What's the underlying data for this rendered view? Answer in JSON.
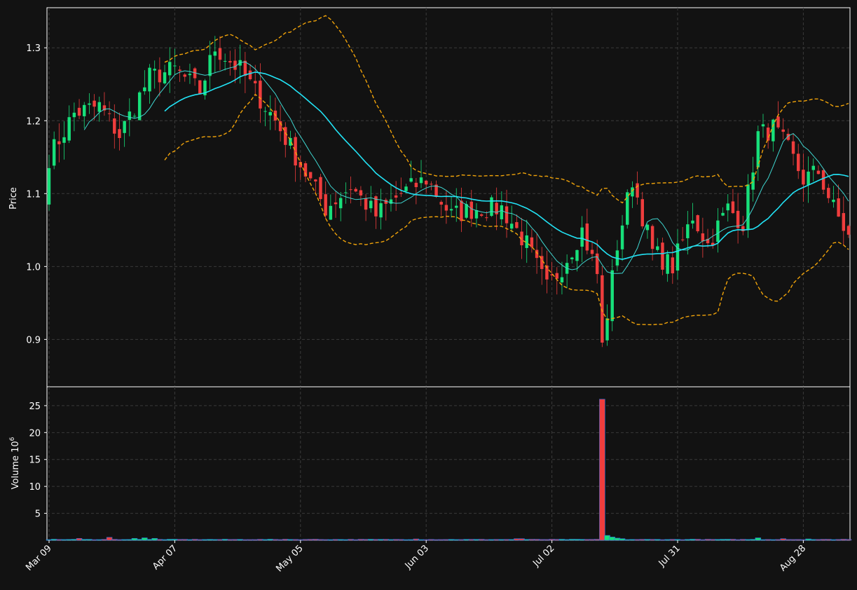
{
  "colors": {
    "background": "#121212",
    "up": "#17e07a",
    "down": "#ef3d3d",
    "ma_fast": "#3fd6d0",
    "ma_slow": "#22e3f5",
    "bollinger": "#f0a30a",
    "grid": "#3a3a3a",
    "frame": "#ffffff",
    "volume_edge": "#2f6fe0"
  },
  "chart_data": [
    {
      "type": "candlestick",
      "ylabel": "Price",
      "ylim": [
        0.835,
        1.355
      ],
      "yticks": [
        "0.9",
        "1.0",
        "1.1",
        "1.2",
        "1.3"
      ],
      "ytick_values": [
        0.9,
        1.0,
        1.1,
        1.2,
        1.3
      ],
      "grid": true,
      "n_bars": 160,
      "x_tick_labels": [
        "Mar 09",
        "Apr 07",
        "May 05",
        "Jun 03",
        "Jul 02",
        "Jul 31",
        "Aug 28"
      ],
      "x_tick_index": [
        0,
        25,
        50,
        75,
        100,
        125,
        150
      ],
      "anchors": [
        [
          0,
          1.15
        ],
        [
          5,
          1.21
        ],
        [
          10,
          1.22
        ],
        [
          14,
          1.18
        ],
        [
          20,
          1.26
        ],
        [
          25,
          1.27
        ],
        [
          30,
          1.24
        ],
        [
          33,
          1.3
        ],
        [
          38,
          1.27
        ],
        [
          45,
          1.2
        ],
        [
          50,
          1.14
        ],
        [
          55,
          1.08
        ],
        [
          60,
          1.11
        ],
        [
          65,
          1.07
        ],
        [
          70,
          1.1
        ],
        [
          75,
          1.12
        ],
        [
          80,
          1.07
        ],
        [
          85,
          1.08
        ],
        [
          90,
          1.08
        ],
        [
          95,
          1.03
        ],
        [
          99,
          0.97
        ],
        [
          102,
          1.0
        ],
        [
          106,
          1.05
        ],
        [
          109,
          0.99
        ],
        [
          110,
          0.89
        ],
        [
          113,
          1.03
        ],
        [
          116,
          1.12
        ],
        [
          120,
          1.02
        ],
        [
          124,
          1.0
        ],
        [
          128,
          1.07
        ],
        [
          131,
          1.03
        ],
        [
          135,
          1.08
        ],
        [
          138,
          1.06
        ],
        [
          141,
          1.18
        ],
        [
          144,
          1.19
        ],
        [
          147,
          1.16
        ],
        [
          150,
          1.12
        ],
        [
          153,
          1.13
        ],
        [
          156,
          1.08
        ],
        [
          159,
          1.04
        ]
      ],
      "bollinger_period": 24,
      "moving_averages": [
        8,
        24
      ],
      "series": [
        {
          "name": "",
          "kind": "ohlc"
        },
        {
          "name": "",
          "kind": "ma_fast"
        },
        {
          "name": "",
          "kind": "ma_slow"
        },
        {
          "name": "",
          "kind": "bollinger_upper"
        },
        {
          "name": "",
          "kind": "bollinger_lower"
        }
      ]
    },
    {
      "type": "bar",
      "ylabel": "Volume  10",
      "ylabel_exp": "6",
      "ylim": [
        0,
        28.5
      ],
      "yticks": [
        "5",
        "10",
        "15",
        "20",
        "25"
      ],
      "ytick_values": [
        5,
        10,
        15,
        20,
        25
      ],
      "grid": true,
      "base_volume": 0.12,
      "spikes": [
        [
          6,
          0.35
        ],
        [
          12,
          0.55
        ],
        [
          17,
          0.35
        ],
        [
          19,
          0.45
        ],
        [
          21,
          0.35
        ],
        [
          47,
          0.2
        ],
        [
          53,
          0.2
        ],
        [
          73,
          0.25
        ],
        [
          93,
          0.3
        ],
        [
          94,
          0.3
        ],
        [
          110,
          26.2
        ],
        [
          111,
          0.9
        ],
        [
          112,
          0.6
        ],
        [
          113,
          0.4
        ],
        [
          114,
          0.3
        ],
        [
          128,
          0.2
        ],
        [
          141,
          0.45
        ],
        [
          146,
          0.3
        ],
        [
          151,
          0.25
        ],
        [
          158,
          0.2
        ]
      ]
    }
  ]
}
